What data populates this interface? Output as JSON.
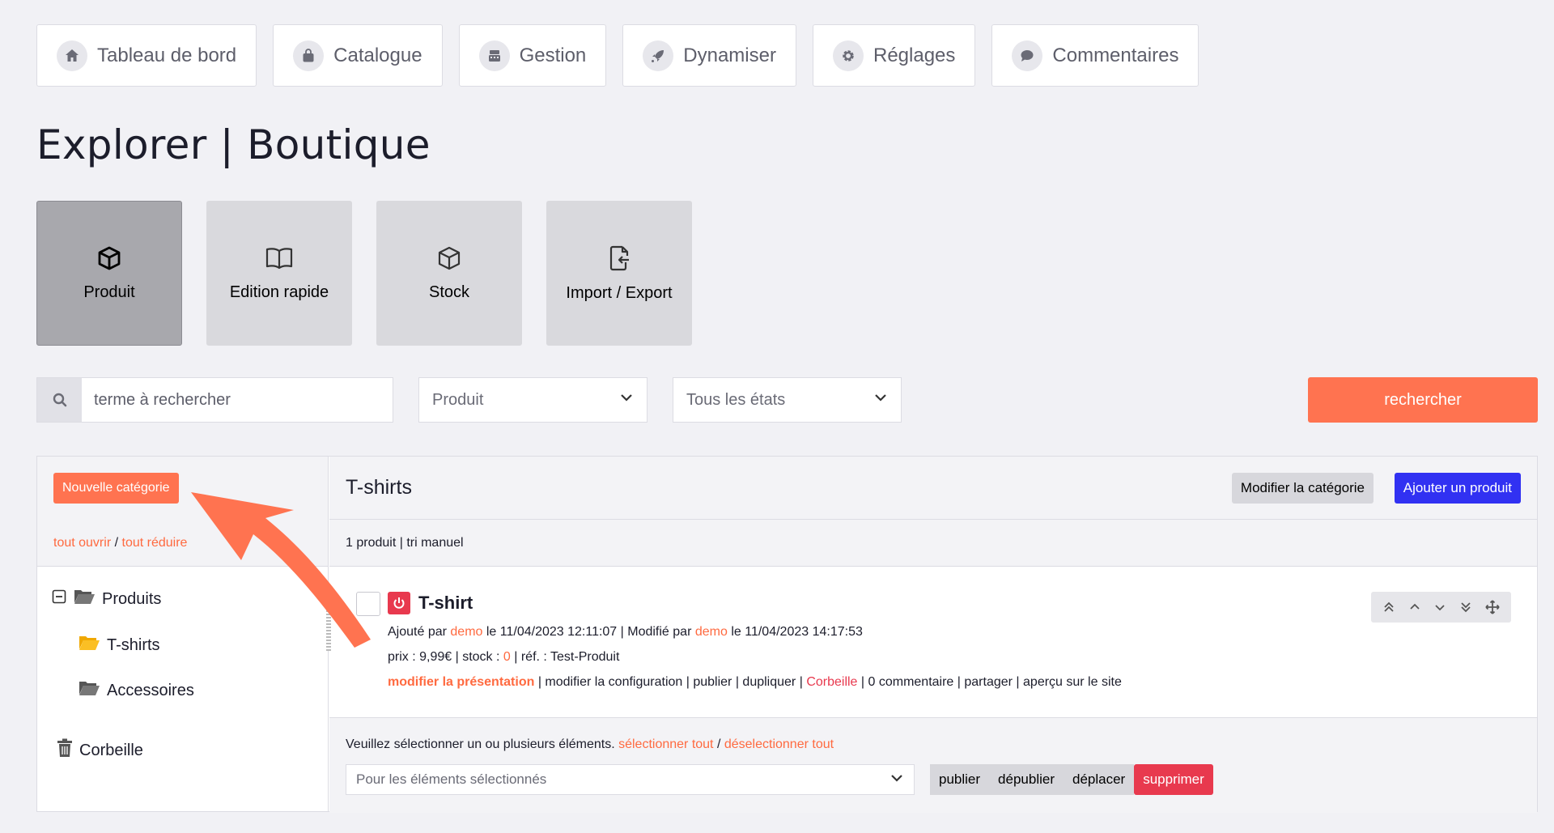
{
  "nav": [
    {
      "label": "Tableau de bord",
      "icon": "home-icon"
    },
    {
      "label": "Catalogue",
      "icon": "bag-icon"
    },
    {
      "label": "Gestion",
      "icon": "register-icon"
    },
    {
      "label": "Dynamiser",
      "icon": "rocket-icon"
    },
    {
      "label": "Réglages",
      "icon": "gear-icon"
    },
    {
      "label": "Commentaires",
      "icon": "comment-icon"
    }
  ],
  "page_title": "Explorer | Boutique",
  "tiles": [
    {
      "label": "Produit",
      "icon": "box-icon",
      "active": true
    },
    {
      "label": "Edition rapide",
      "icon": "book-icon",
      "active": false
    },
    {
      "label": "Stock",
      "icon": "box-icon",
      "active": false
    },
    {
      "label": "Import / Export",
      "icon": "file-import-icon",
      "active": false
    }
  ],
  "search": {
    "placeholder": "terme à rechercher",
    "type_select": "Produit",
    "state_select": "Tous les états",
    "button": "rechercher"
  },
  "left": {
    "new_category": "Nouvelle catégorie",
    "open_all": "tout ouvrir",
    "separator": "/",
    "collapse_all": "tout réduire",
    "tree": [
      {
        "label": "Produits"
      },
      {
        "label": "T-shirts"
      },
      {
        "label": "Accessoires"
      }
    ],
    "trash": "Corbeille"
  },
  "right": {
    "category_title": "T-shirts",
    "edit_category": "Modifier la catégorie",
    "add_product": "Ajouter un produit",
    "summary": "1 produit | tri manuel",
    "product": {
      "name": "T-shirt",
      "added_prefix": "Ajouté par",
      "added_by": "demo",
      "added_date": "le 11/04/2023 12:11:07 | Modifié par",
      "modified_by": "demo",
      "modified_date": "le 11/04/2023 14:17:53",
      "price_text": "prix : 9,99€ | stock :",
      "stock": "0",
      "ref_text": "| réf. : Test-Produit",
      "action_main": "modifier la présentation",
      "actions_mid": "| modifier la configuration | publier | dupliquer |",
      "action_trash": "Corbeille",
      "actions_end": "| 0 commentaire | partager | aperçu sur le site"
    },
    "footer": {
      "message": "Veuillez sélectionner un ou plusieurs éléments.",
      "select_all": "sélectionner tout",
      "separator": "/",
      "deselect_all": "déselectionner tout",
      "bulk_placeholder": "Pour les éléments sélectionnés",
      "publish": "publier",
      "unpublish": "dépublier",
      "move": "déplacer",
      "delete": "supprimer"
    }
  },
  "colors": {
    "accent": "#ff7350",
    "primary": "#3131f2",
    "danger": "#e8394e",
    "annotation_arrow": "#ff7350"
  }
}
